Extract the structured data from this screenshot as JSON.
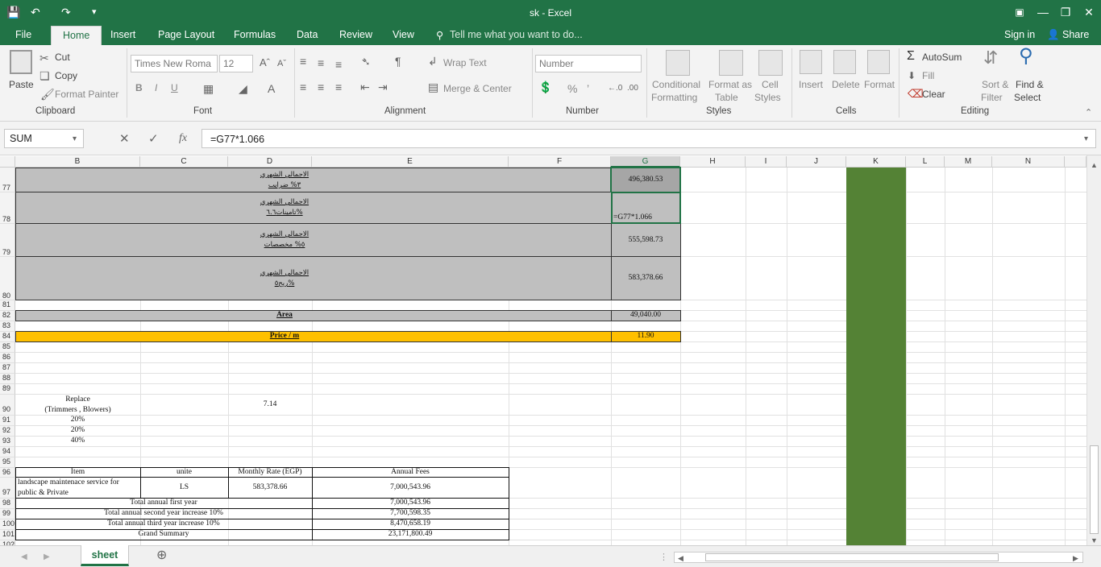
{
  "app": {
    "title": "sk - Excel"
  },
  "tabs": {
    "file": "File",
    "home": "Home",
    "insert": "Insert",
    "page_layout": "Page Layout",
    "formulas": "Formulas",
    "data": "Data",
    "review": "Review",
    "view": "View",
    "tell_me": "Tell me what you want to do...",
    "sign_in": "Sign in",
    "share": "Share"
  },
  "ribbon": {
    "clipboard": {
      "paste": "Paste",
      "cut": "Cut",
      "copy": "Copy",
      "format_painter": "Format Painter",
      "label": "Clipboard"
    },
    "font": {
      "name": "Times New Roma",
      "size": "12",
      "bold": "B",
      "italic": "I",
      "underline": "U",
      "label": "Font"
    },
    "alignment": {
      "wrap_text": "Wrap Text",
      "merge_center": "Merge & Center",
      "label": "Alignment"
    },
    "number": {
      "format": "Number",
      "percent": "%",
      "comma": "’",
      "label": "Number"
    },
    "styles": {
      "conditional": "Conditional",
      "conditional2": "Formatting",
      "format_as": "Format as",
      "format_as2": "Table",
      "cell": "Cell",
      "cell2": "Styles",
      "label": "Styles"
    },
    "cells": {
      "insert": "Insert",
      "delete": "Delete",
      "format": "Format",
      "label": "Cells"
    },
    "editing": {
      "autosum": "AutoSum",
      "fill": "Fill",
      "clear": "Clear",
      "sort": "Sort &",
      "sort2": "Filter",
      "find": "Find &",
      "find2": "Select",
      "label": "Editing"
    }
  },
  "formula_bar": {
    "name_box": "SUM",
    "formula": "=G77*1.066",
    "fx": "fx"
  },
  "columns": [
    "B",
    "C",
    "D",
    "E",
    "F",
    "G",
    "H",
    "I",
    "J",
    "K",
    "L",
    "M",
    "N"
  ],
  "rows": [
    "77",
    "78",
    "79",
    "80",
    "81",
    "82",
    "83",
    "84",
    "85",
    "86",
    "87",
    "88",
    "89",
    "90",
    "91",
    "92",
    "93",
    "94",
    "95",
    "96",
    "97",
    "98",
    "99",
    "100",
    "101",
    "102"
  ],
  "cells": {
    "d77a": "الاجمالي الشهري",
    "d77b": "٣% ضرايب",
    "d78a": "الاجمالي الشهري",
    "d78b": "تامينات٦.٦%",
    "d79a": "الاجمالي الشهري",
    "d79b": "٥% مخصصات",
    "d80a": "الاجمالي الشهري",
    "d80b": "ربح٥%",
    "g77": "496,380.53",
    "g78": "=G77*1.066",
    "g79": "555,598.73",
    "g80": "583,378.66",
    "d82": "Area",
    "g82": "49,040.00",
    "d84": "Price / m",
    "g84": "11.90",
    "b90a": "Replace",
    "b90b": "(Trimmers , Blowers)",
    "d90": "7.14",
    "b91": "20%",
    "b92": "20%",
    "b93": "40%",
    "t_item": "Item",
    "t_unite": "unite",
    "t_rate": "Monthly Rate (EGP)",
    "t_fees": "Annual Fees",
    "t_desc_a": "landscape maintenace service for",
    "t_desc_b": "public & Private",
    "t_ls": "LS",
    "t_rate_v": "583,378.66",
    "t_fees_v": "7,000,543.96",
    "t98": "Total annual first year",
    "t98v": "7,000,543.96",
    "t99": "Total annual second year increase 10%",
    "t99v": "7,700,598.35",
    "t100": "Total annual third year increase 10%",
    "t100v": "8,470,658.19",
    "t101": "Grand Summary",
    "t101v": "23,171,800.49"
  },
  "sheet_tab": "sheet",
  "colors": {
    "excel_green": "#217346",
    "k_column": "#548235",
    "orange": "#ffc000",
    "gray_fill": "#bfbfbf"
  }
}
